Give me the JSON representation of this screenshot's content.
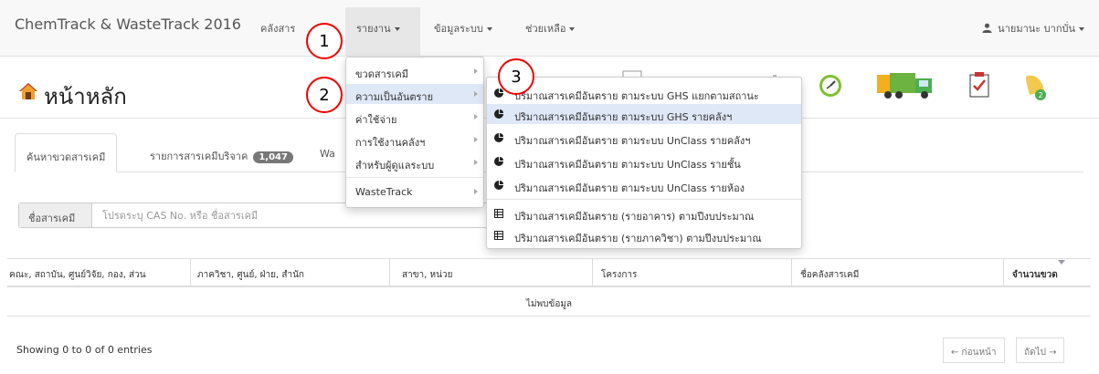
{
  "navbar": {
    "brand": "ChemTrack & WasteTrack 2016",
    "menu_1": "คลังสาร",
    "reports": "รายงาน",
    "system_data": "ข้อมูลระบบ",
    "help": "ช่วยเหลือ",
    "user": "นายมานะ บากบั่น",
    "user_icon": "user-icon"
  },
  "page": {
    "title": "หน้าหลัก",
    "home_icon": "home-icon"
  },
  "toolbar_icons": [
    "document-icon",
    "chart-icon",
    "bar-icon",
    "timer-icon",
    "truck-icon",
    "checklist-icon",
    "bell-icon"
  ],
  "tabs": {
    "search": "ค้นหาขวดสารเคมี",
    "donate": "รายการสารเคมีบริจาค",
    "donate_count": "1,047",
    "third": "Wa"
  },
  "search": {
    "label": "ชื่อสารเคมี",
    "placeholder": "โปรดระบุ CAS No. หรือ ชื่อสารเคมี"
  },
  "table": {
    "columns": [
      "คณะ, สถาบัน, ศูนย์วิจัย, กอง, ส่วน",
      "ภาควิชา, ศูนย์, ฝ่าย, สำนัก",
      "สาขา, หน่วย",
      "โครงการ",
      "ชื่อคลังสารเคมี",
      "จำนวนขวด"
    ],
    "empty_message": "ไม่พบข้อมูล",
    "entries_info": "Showing 0 to 0 of 0 entries",
    "prev": "← ก่อนหน้า",
    "next": "ถัดไป →"
  },
  "reports_menu": {
    "items": [
      "ขวดสารเคมี",
      "ความเป็นอันตราย",
      "ค่าใช้จ่าย",
      "การใช้งานคลังฯ",
      "สำหรับผู้ดูแลระบบ",
      "WasteTrack"
    ]
  },
  "hazard_submenu": {
    "items": [
      "ปริมาณสารเคมีอันตราย ตามระบบ GHS แยกตามสถานะ",
      "ปริมาณสารเคมีอันตราย ตามระบบ GHS รายคลังฯ",
      "ปริมาณสารเคมีอันตราย ตามระบบ UnClass รายคลังฯ",
      "ปริมาณสารเคมีอันตราย ตามระบบ UnClass รายชั้น",
      "ปริมาณสารเคมีอันตราย ตามระบบ UnClass รายห้อง",
      "ปริมาณสารเคมีอันตราย (รายอาคาร) ตามปีงบประมาณ",
      "ปริมาณสารเคมีอันตราย (รายภาควิชา) ตามปีงบประมาณ"
    ],
    "icons": [
      "pie-chart-icon",
      "pie-chart-icon",
      "pie-chart-icon",
      "pie-chart-icon",
      "pie-chart-icon",
      "table-icon",
      "table-icon"
    ]
  },
  "callouts": [
    "1",
    "2",
    "3"
  ],
  "colors": {
    "navbar_bg": "#f8f8f8",
    "highlight": "#dfe8f7",
    "callout_border": "#ee0000",
    "badge_bg": "#777777"
  }
}
